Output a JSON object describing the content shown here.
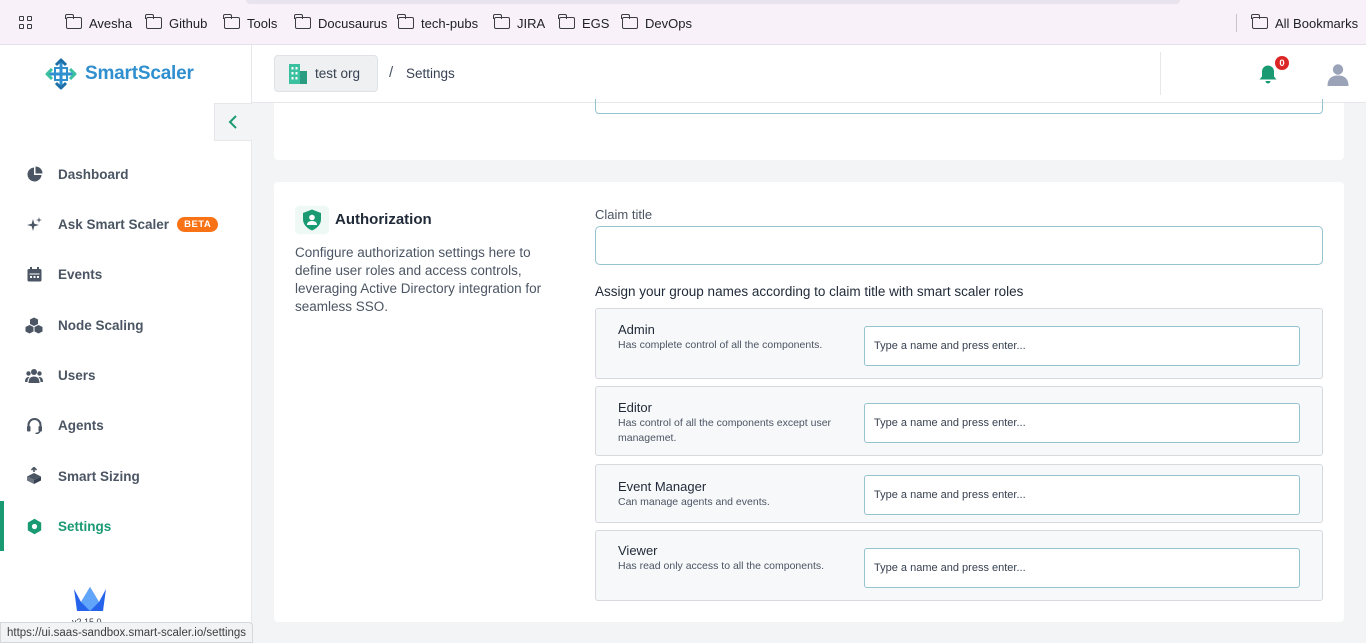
{
  "bookmarks": {
    "apps_icon": "apps-grid-icon",
    "items": [
      "Avesha",
      "Github",
      "Tools",
      "Docusaurus",
      "tech-pubs",
      "JIRA",
      "EGS",
      "DevOps"
    ],
    "all_bookmarks": "All Bookmarks"
  },
  "sidebar": {
    "brand": "SmartScaler",
    "collapse_icon": "chevron-left-icon",
    "items": [
      {
        "label": "Dashboard",
        "icon": "pie-chart-icon"
      },
      {
        "label": "Ask Smart Scaler",
        "icon": "sparkle-icon",
        "badge": "BETA"
      },
      {
        "label": "Events",
        "icon": "calendar-icon"
      },
      {
        "label": "Node Scaling",
        "icon": "cubes-icon"
      },
      {
        "label": "Users",
        "icon": "users-icon"
      },
      {
        "label": "Agents",
        "icon": "headset-icon"
      },
      {
        "label": "Smart Sizing",
        "icon": "box-icon"
      },
      {
        "label": "Settings",
        "icon": "gear-icon"
      }
    ],
    "active": "Settings",
    "version": "v2.15.0"
  },
  "header": {
    "org": "test org",
    "separator": "/",
    "current_page": "Settings",
    "notification_count": "0"
  },
  "authorization": {
    "title": "Authorization",
    "description": "Configure authorization settings here to define user roles and access controls, leveraging Active Directory integration for seamless SSO.",
    "claim_label": "Claim title",
    "claim_value": "",
    "assign_label": "Assign your group names according to claim title with smart scaler roles",
    "roles": [
      {
        "name": "Admin",
        "description": "Has complete control of all the components.",
        "placeholder": "Type a name and press enter..."
      },
      {
        "name": "Editor",
        "description": "Has control of all the components except user managemet.",
        "placeholder": "Type a name and press enter..."
      },
      {
        "name": "Event Manager",
        "description": "Can manage agents and events.",
        "placeholder": "Type a name and press enter..."
      },
      {
        "name": "Viewer",
        "description": "Has read only access to all the components.",
        "placeholder": "Type a name and press enter..."
      }
    ]
  },
  "statusbar": {
    "url": "https://ui.saas-sandbox.smart-scaler.io/settings"
  },
  "colors": {
    "accent": "#1a9a73",
    "brand_blue": "#2f8fcf",
    "beta": "#f97316",
    "badge": "#dc2626",
    "input_border": "#94c2cf"
  }
}
